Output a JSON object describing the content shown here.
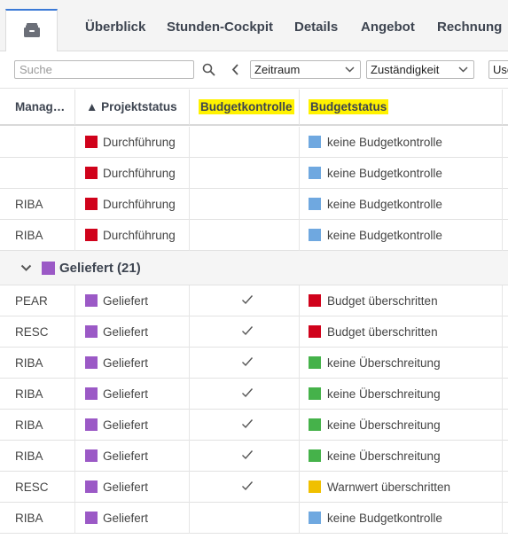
{
  "tabs": {
    "home_icon": "inbox-icon",
    "items": [
      "Überblick",
      "Stunden-Cockpit",
      "Details",
      "Angebot",
      "Rechnung"
    ]
  },
  "filters": {
    "search_placeholder": "Suche",
    "period": "Zeitraum",
    "responsibility": "Zuständigkeit",
    "user": "Use"
  },
  "columns": [
    "Manag…",
    "▲ Projektstatus",
    "Budgetkontrolle",
    "Budgetstatus"
  ],
  "colors": {
    "red": "#d0021b",
    "blue": "#6fa8e0",
    "purple": "#9b59c6",
    "green": "#45b24a",
    "yellow": "#f0c000",
    "highlight": "#fff200",
    "accent": "#3a79d6"
  },
  "rows_top": [
    {
      "manager": "",
      "status": "Durchführung",
      "status_color": "red",
      "budget_control": false,
      "budget_status": "keine Budgetkontrolle",
      "budget_color": "blue"
    },
    {
      "manager": "",
      "status": "Durchführung",
      "status_color": "red",
      "budget_control": false,
      "budget_status": "keine Budgetkontrolle",
      "budget_color": "blue"
    },
    {
      "manager": "RIBA",
      "status": "Durchführung",
      "status_color": "red",
      "budget_control": false,
      "budget_status": "keine Budgetkontrolle",
      "budget_color": "blue"
    },
    {
      "manager": "RIBA",
      "status": "Durchführung",
      "status_color": "red",
      "budget_control": false,
      "budget_status": "keine Budgetkontrolle",
      "budget_color": "blue"
    }
  ],
  "group": {
    "label": "Geliefert (21)",
    "color": "purple",
    "expanded": true
  },
  "rows_bottom": [
    {
      "manager": "PEAR",
      "status": "Geliefert",
      "status_color": "purple",
      "budget_control": true,
      "budget_status": "Budget überschritten",
      "budget_color": "red"
    },
    {
      "manager": "RESC",
      "status": "Geliefert",
      "status_color": "purple",
      "budget_control": true,
      "budget_status": "Budget überschritten",
      "budget_color": "red"
    },
    {
      "manager": "RIBA",
      "status": "Geliefert",
      "status_color": "purple",
      "budget_control": true,
      "budget_status": "keine Überschreitung",
      "budget_color": "green"
    },
    {
      "manager": "RIBA",
      "status": "Geliefert",
      "status_color": "purple",
      "budget_control": true,
      "budget_status": "keine Überschreitung",
      "budget_color": "green"
    },
    {
      "manager": "RIBA",
      "status": "Geliefert",
      "status_color": "purple",
      "budget_control": true,
      "budget_status": "keine Überschreitung",
      "budget_color": "green"
    },
    {
      "manager": "RIBA",
      "status": "Geliefert",
      "status_color": "purple",
      "budget_control": true,
      "budget_status": "keine Überschreitung",
      "budget_color": "green"
    },
    {
      "manager": "RESC",
      "status": "Geliefert",
      "status_color": "purple",
      "budget_control": true,
      "budget_status": "Warnwert überschritten",
      "budget_color": "yellow"
    },
    {
      "manager": "RIBA",
      "status": "Geliefert",
      "status_color": "purple",
      "budget_control": false,
      "budget_status": "keine Budgetkontrolle",
      "budget_color": "blue"
    }
  ]
}
